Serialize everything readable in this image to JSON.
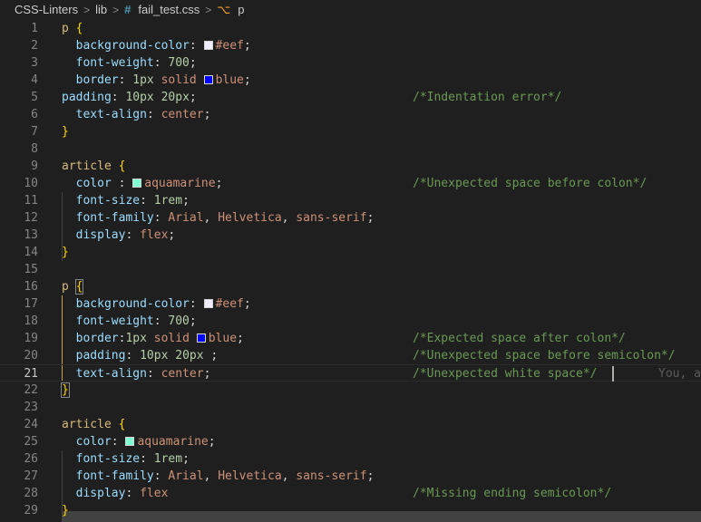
{
  "breadcrumb": {
    "items": [
      "CSS-Linters",
      "lib",
      "fail_test.css",
      "p"
    ],
    "separator": ">"
  },
  "colors": {
    "eef": "#eeeeff",
    "blue": "#0000ff",
    "aquamarine": "#7fffd4"
  },
  "lines": [
    {
      "n": "1",
      "t": [
        [
          "sel",
          "p"
        ],
        [
          "punc",
          " "
        ],
        [
          "brace",
          "{"
        ]
      ]
    },
    {
      "n": "2",
      "t": [
        [
          "punc",
          "  "
        ],
        [
          "prop",
          "background-color"
        ],
        [
          "punc",
          ": "
        ],
        [
          "sw",
          "eef"
        ],
        [
          "val",
          "#eef"
        ],
        [
          "punc",
          ";"
        ]
      ]
    },
    {
      "n": "3",
      "t": [
        [
          "punc",
          "  "
        ],
        [
          "prop",
          "font-weight"
        ],
        [
          "punc",
          ": "
        ],
        [
          "num",
          "700"
        ],
        [
          "punc",
          ";"
        ]
      ]
    },
    {
      "n": "4",
      "t": [
        [
          "punc",
          "  "
        ],
        [
          "prop",
          "border"
        ],
        [
          "punc",
          ": "
        ],
        [
          "num",
          "1px"
        ],
        [
          "punc",
          " "
        ],
        [
          "val",
          "solid"
        ],
        [
          "punc",
          " "
        ],
        [
          "sw",
          "blue"
        ],
        [
          "val",
          "blue"
        ],
        [
          "punc",
          ";"
        ]
      ]
    },
    {
      "n": "5",
      "t": [
        [
          "prop",
          "padding"
        ],
        [
          "punc",
          ": "
        ],
        [
          "num",
          "10px"
        ],
        [
          "punc",
          " "
        ],
        [
          "num",
          "20px"
        ],
        [
          "punc",
          ";"
        ]
      ],
      "c": "/*Indentation error*/"
    },
    {
      "n": "6",
      "t": [
        [
          "punc",
          "  "
        ],
        [
          "prop",
          "text-align"
        ],
        [
          "punc",
          ": "
        ],
        [
          "val",
          "center"
        ],
        [
          "punc",
          ";"
        ]
      ]
    },
    {
      "n": "7",
      "t": [
        [
          "brace",
          "}"
        ]
      ]
    },
    {
      "n": "8",
      "t": []
    },
    {
      "n": "9",
      "t": [
        [
          "sel",
          "article"
        ],
        [
          "punc",
          " "
        ],
        [
          "brace",
          "{"
        ]
      ]
    },
    {
      "n": "10",
      "t": [
        [
          "punc",
          "  "
        ],
        [
          "prop",
          "color"
        ],
        [
          "punc",
          " : "
        ],
        [
          "sw",
          "aquamarine"
        ],
        [
          "val",
          "aquamarine"
        ],
        [
          "punc",
          ";"
        ]
      ],
      "c": "/*Unexpected space before colon*/"
    },
    {
      "n": "11",
      "t": [
        [
          "punc",
          "  "
        ],
        [
          "prop",
          "font-size"
        ],
        [
          "punc",
          ": "
        ],
        [
          "num",
          "1rem"
        ],
        [
          "punc",
          ";"
        ]
      ]
    },
    {
      "n": "12",
      "t": [
        [
          "punc",
          "  "
        ],
        [
          "prop",
          "font-family"
        ],
        [
          "punc",
          ": "
        ],
        [
          "val",
          "Arial"
        ],
        [
          "punc",
          ", "
        ],
        [
          "val",
          "Helvetica"
        ],
        [
          "punc",
          ", "
        ],
        [
          "val",
          "sans-serif"
        ],
        [
          "punc",
          ";"
        ]
      ]
    },
    {
      "n": "13",
      "t": [
        [
          "punc",
          "  "
        ],
        [
          "prop",
          "display"
        ],
        [
          "punc",
          ": "
        ],
        [
          "val",
          "flex"
        ],
        [
          "punc",
          ";"
        ]
      ]
    },
    {
      "n": "14",
      "t": [
        [
          "brace",
          "}"
        ]
      ]
    },
    {
      "n": "15",
      "t": []
    },
    {
      "n": "16",
      "t": [
        [
          "sel",
          "p"
        ],
        [
          "punc",
          " "
        ],
        [
          "bracem",
          "{"
        ]
      ]
    },
    {
      "n": "17",
      "t": [
        [
          "punc",
          "  "
        ],
        [
          "prop",
          "background-color"
        ],
        [
          "punc",
          ": "
        ],
        [
          "sw",
          "eef"
        ],
        [
          "val",
          "#eef"
        ],
        [
          "punc",
          ";"
        ]
      ]
    },
    {
      "n": "18",
      "t": [
        [
          "punc",
          "  "
        ],
        [
          "prop",
          "font-weight"
        ],
        [
          "punc",
          ": "
        ],
        [
          "num",
          "700"
        ],
        [
          "punc",
          ";"
        ]
      ]
    },
    {
      "n": "19",
      "t": [
        [
          "punc",
          "  "
        ],
        [
          "prop",
          "border"
        ],
        [
          "punc",
          ":"
        ],
        [
          "num",
          "1px"
        ],
        [
          "punc",
          " "
        ],
        [
          "val",
          "solid"
        ],
        [
          "punc",
          " "
        ],
        [
          "sw",
          "blue"
        ],
        [
          "val",
          "blue"
        ],
        [
          "punc",
          ";"
        ]
      ],
      "c": "/*Expected space after colon*/"
    },
    {
      "n": "20",
      "t": [
        [
          "punc",
          "  "
        ],
        [
          "prop",
          "padding"
        ],
        [
          "punc",
          ": "
        ],
        [
          "num",
          "10px"
        ],
        [
          "punc",
          " "
        ],
        [
          "num",
          "20px"
        ],
        [
          "punc",
          " ;"
        ]
      ],
      "c": "/*Unexpected space before semicolon*/"
    },
    {
      "n": "21",
      "t": [
        [
          "punc",
          "  "
        ],
        [
          "prop",
          "text-align"
        ],
        [
          "punc",
          ": "
        ],
        [
          "val",
          "center"
        ],
        [
          "punc",
          ";"
        ]
      ],
      "c": "/*Unexpected white space*/",
      "cursor": true,
      "ghost": "You, a"
    },
    {
      "n": "22",
      "t": [
        [
          "bracem",
          "}"
        ]
      ]
    },
    {
      "n": "23",
      "t": []
    },
    {
      "n": "24",
      "t": [
        [
          "sel",
          "article"
        ],
        [
          "punc",
          " "
        ],
        [
          "brace",
          "{"
        ]
      ]
    },
    {
      "n": "25",
      "t": [
        [
          "punc",
          "  "
        ],
        [
          "prop",
          "color"
        ],
        [
          "punc",
          ": "
        ],
        [
          "sw",
          "aquamarine"
        ],
        [
          "val",
          "aquamarine"
        ],
        [
          "punc",
          ";"
        ]
      ]
    },
    {
      "n": "26",
      "t": [
        [
          "punc",
          "  "
        ],
        [
          "prop",
          "font-size"
        ],
        [
          "punc",
          ": "
        ],
        [
          "num",
          "1rem"
        ],
        [
          "punc",
          ";"
        ]
      ]
    },
    {
      "n": "27",
      "t": [
        [
          "punc",
          "  "
        ],
        [
          "prop",
          "font-family"
        ],
        [
          "punc",
          ": "
        ],
        [
          "val",
          "Arial"
        ],
        [
          "punc",
          ", "
        ],
        [
          "val",
          "Helvetica"
        ],
        [
          "punc",
          ", "
        ],
        [
          "val",
          "sans-serif"
        ],
        [
          "punc",
          ";"
        ]
      ]
    },
    {
      "n": "28",
      "t": [
        [
          "punc",
          "  "
        ],
        [
          "prop",
          "display"
        ],
        [
          "punc",
          ": "
        ],
        [
          "val",
          "flex"
        ]
      ],
      "c": "/*Missing ending semicolon*/"
    },
    {
      "n": "29",
      "t": [
        [
          "brace",
          "}"
        ]
      ]
    }
  ]
}
